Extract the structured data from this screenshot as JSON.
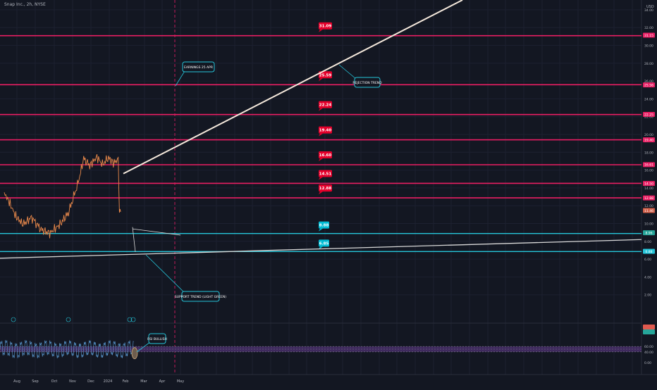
{
  "header": {
    "title": "Snap Inc., 2h, NYSE"
  },
  "axis": {
    "currency": "USD",
    "ticks": [
      "34.00",
      "32.00",
      "30.00",
      "28.00",
      "26.00",
      "24.00",
      "22.00",
      "20.00",
      "18.00",
      "16.00",
      "14.00",
      "12.00",
      "10.00",
      "8.00",
      "6.00",
      "4.00",
      "2.00"
    ],
    "months": [
      "Aug",
      "Sep",
      "Oct",
      "Nov",
      "Dec",
      "2024",
      "Feb",
      "Mar",
      "Apr",
      "May"
    ]
  },
  "chart_data": {
    "type": "line",
    "title": "Snap Inc., 2h, NYSE",
    "xlabel": "",
    "ylabel": "USD",
    "ylim": [
      0,
      36
    ],
    "x_categories": [
      "Aug",
      "Sep",
      "Oct",
      "Nov",
      "Dec",
      "2024",
      "Feb",
      "Mar",
      "Apr",
      "May"
    ],
    "series": [
      {
        "name": "",
        "x": [
          "2023-08-01",
          "2023-08-08",
          "2023-08-20",
          "2023-09-01",
          "2023-09-15",
          "2023-10-01",
          "2023-10-15",
          "2023-11-01",
          "2023-11-15",
          "2023-12-01",
          "2023-12-10",
          "2023-12-20",
          "2024-01-01",
          "2024-01-10",
          "2024-01-20",
          "2024-01-28",
          "2024-02-05",
          "2024-02-07",
          "2024-02-09"
        ],
        "values": [
          13.4,
          12.6,
          10.8,
          9.9,
          10.7,
          9.3,
          8.9,
          9.9,
          11.2,
          14.6,
          17.3,
          16.5,
          17.5,
          16.6,
          17.4,
          16.8,
          17.2,
          11.1,
          11.3
        ]
      }
    ],
    "resistance_levels": [
      31.09,
      25.59,
      22.24,
      19.4,
      16.6,
      14.51,
      12.88
    ],
    "support_levels": [
      8.88,
      6.85
    ],
    "rsi": {
      "mid_level": 50.0,
      "upper_level": 60.0,
      "lower_level": 40.0,
      "ticks": [
        "60.00",
        "40.00",
        "0.00"
      ]
    }
  },
  "price_labels": {
    "resistance": [
      "31.09",
      "25.59",
      "22.24",
      "19.40",
      "16.60",
      "14.51",
      "12.88"
    ],
    "support": [
      "8.88",
      "6.85"
    ]
  },
  "axis_level_tags": [
    "31.15",
    "25.56",
    "22.25",
    "19.40",
    "16.61",
    "14.50",
    "12.88",
    "11.46",
    "8.96",
    "6.88"
  ],
  "annotations": {
    "earnings": "EARNINGS 25 APR",
    "rejection": "REJECTION TREND",
    "support": "SUPPORT TREND (LIGHT GREEN)",
    "rsi": "RSI BULLISH"
  },
  "colors": {
    "background": "#131722",
    "resistance": "#e91e63",
    "resistance_label": "#e4002b",
    "support": "#26c6da",
    "support_label": "#00bcd4",
    "price": "#e8884a",
    "rsi": "#5b9bd5",
    "rsi_band": "#3f2a5e",
    "trend": "#f5e9dc"
  }
}
